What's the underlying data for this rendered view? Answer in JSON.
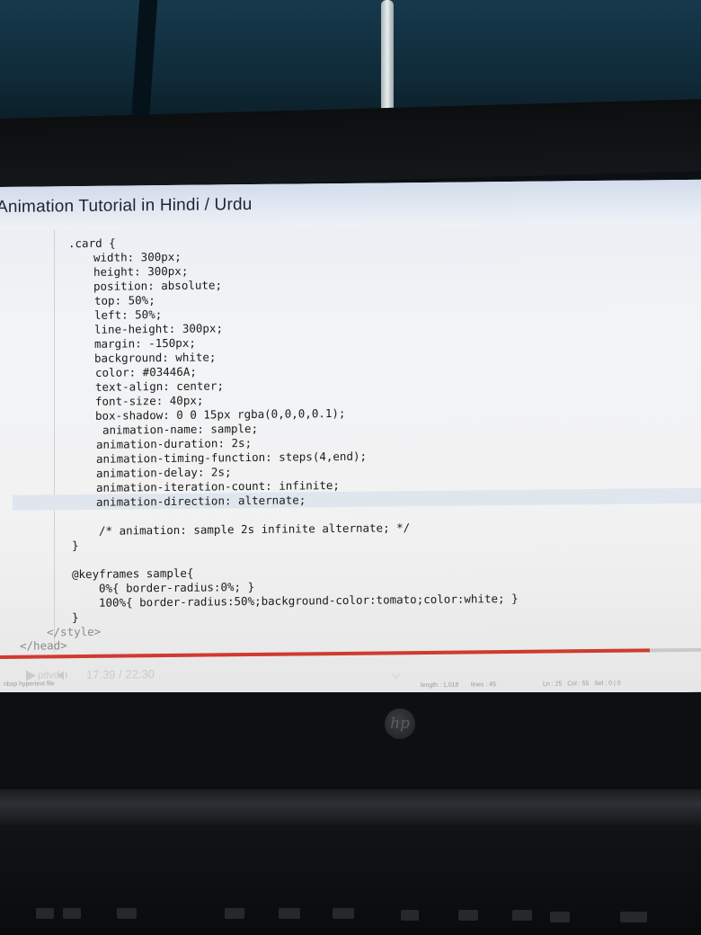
{
  "window": {
    "title": "Animation Tutorial in Hindi / Urdu"
  },
  "code": {
    "lines": [
      ".card {",
      "width: 300px;",
      "height: 300px;",
      "position: absolute;",
      "top: 50%;",
      "left: 50%;",
      "line-height: 300px;",
      "margin: -150px;",
      "background: white;",
      "color: #03446A;",
      "text-align: center;",
      "font-size: 40px;",
      "box-shadow: 0 0 15px rgba(0,0,0,0.1);",
      "animation-name: sample;",
      "animation-duration: 2s;",
      "animation-timing-function: steps(4,end);",
      "animation-delay: 2s;",
      "animation-iteration-count: infinite;",
      "animation-direction: alternate;",
      "/* animation: sample 2s infinite alternate; */",
      "}",
      "@keyframes sample{",
      "0%{ border-radius:0%; }",
      "100%{ border-radius:50%;background-color:tomato;color:white; }",
      "}",
      "</style>",
      "</head>"
    ]
  },
  "player": {
    "logo": "pdvd",
    "time": "17:39 / 22:30",
    "progress": 0.92,
    "accent": "#d13a30"
  },
  "status_bar": {
    "left": "nbsp hypertext file",
    "length": "length : 1,018",
    "lines": "lines : 45",
    "position": "Ln : 25   Col : 55   Sel : 0 | 0"
  },
  "device": {
    "brand_logo": "hp"
  },
  "icons": [
    "play-icon",
    "volume-icon",
    "chevron-down-icon"
  ]
}
